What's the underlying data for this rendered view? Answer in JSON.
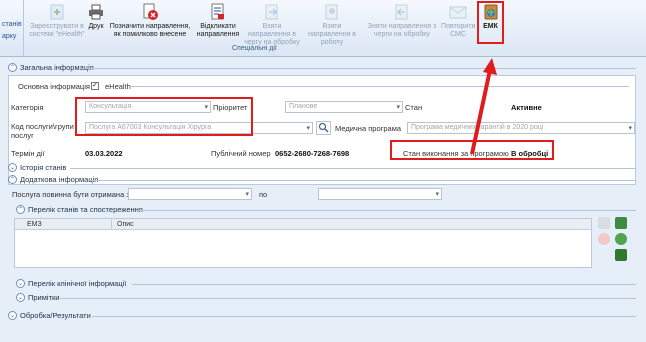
{
  "ribbon": {
    "left_label_1": "станів",
    "left_label_2": "арку",
    "buttons": [
      {
        "label": "Зареєструвати в системі \"eHealth\"",
        "icon": "register-ehealth-icon",
        "disabled": true
      },
      {
        "label": "Друк",
        "icon": "print-icon",
        "disabled": false
      },
      {
        "label": "Позначити направлення, як помилково внесене",
        "icon": "mark-error-icon",
        "disabled": false
      },
      {
        "label": "Відкликати направлення",
        "icon": "revoke-referral-icon",
        "disabled": false
      },
      {
        "label": "Взяти направлення в чергу на обробку",
        "icon": "queue-add-icon",
        "disabled": true
      },
      {
        "label": "Взяти направлення в роботу",
        "icon": "take-to-work-icon",
        "disabled": true
      },
      {
        "label": "Зняти направлення з черги на обробку",
        "icon": "queue-remove-icon",
        "disabled": true
      },
      {
        "label": "Повторити СМС",
        "icon": "sms-icon",
        "disabled": true
      },
      {
        "label": "ЕМК",
        "icon": "emk-icon",
        "disabled": false
      }
    ],
    "group_label": "Спеціальні дії"
  },
  "general": {
    "title": "Загальна інформація",
    "basic_info_label": "Основна інформація",
    "ehealth_label": "eHealth",
    "ehealth_checked": true,
    "category_label": "Категорія",
    "category_value": "Консультація",
    "priority_label": "Пріоритет",
    "priority_value": "Планове",
    "state_label": "Стан",
    "state_value": "Активне",
    "service_code_label": "Код послуги\\групи послуг",
    "service_code_value": "Послуга A67003 Консультація Хірурга",
    "medical_program_label": "Медична програма",
    "medical_program_value": "Програма медичних гарантій в 2020 році",
    "term_label": "Термін дії",
    "term_value": "03.03.2022",
    "public_number_label": "Публічний номер",
    "public_number_value": "0652-2680-7268-7698",
    "program_state_label": "Стан виконання за програмою",
    "program_state_value": "В обробці"
  },
  "history": {
    "title": "Історія станів"
  },
  "additional": {
    "title": "Додаткова інформація",
    "service_received_label": "Послуга повинна бути отримана з",
    "to_label": "по",
    "date_from": "",
    "date_to": ""
  },
  "states_list": {
    "title": "Перелік станів та спостереження",
    "columns": [
      "ЕМЗ",
      "Опис"
    ]
  },
  "clinical": {
    "title": "Перелік клінічної інформації"
  },
  "notes": {
    "title": "Примітки"
  },
  "processing": {
    "title": "Обробка/Результати"
  }
}
